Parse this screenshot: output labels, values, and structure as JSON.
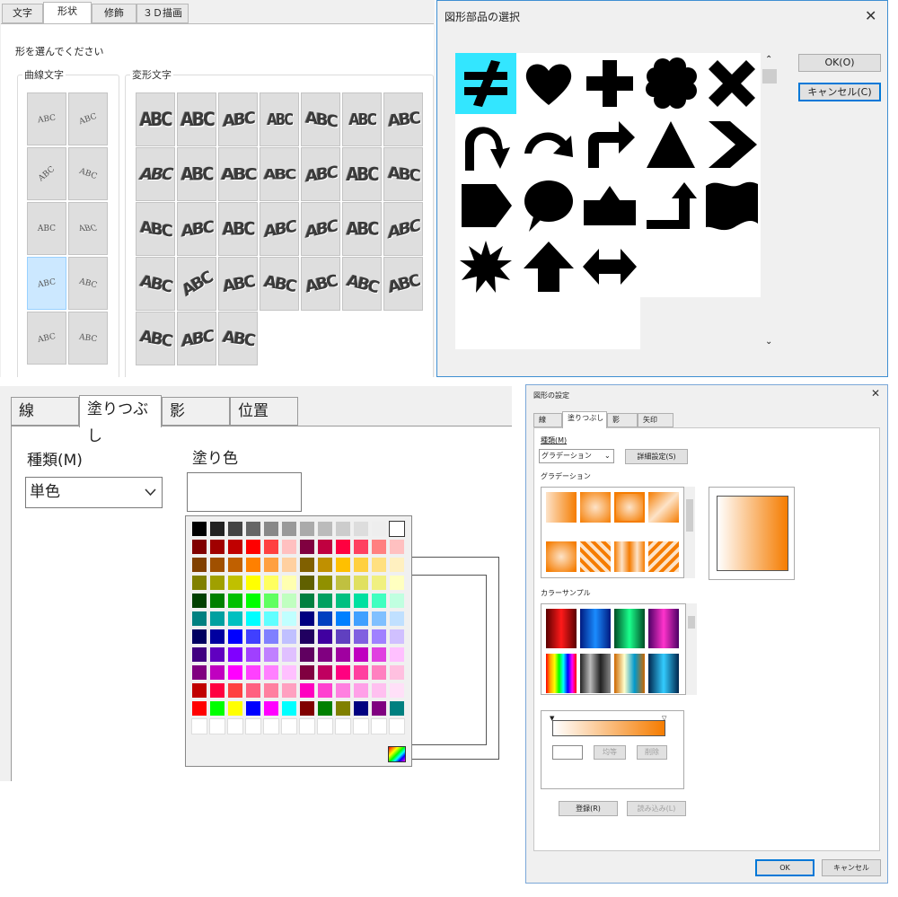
{
  "wordart_panel": {
    "tabs": [
      "文字",
      "形状",
      "修飾",
      "３Ｄ描画"
    ],
    "active_tab": "形状",
    "instruction": "形を選んでください",
    "curve_group_label": "曲線文字",
    "transform_group_label": "変形文字",
    "curve_samples": [
      "ABC",
      "ABC",
      "ABC",
      "ABC",
      "ABC",
      "ABC",
      "ABC",
      "ABC",
      "ABC",
      "ABC"
    ],
    "transform_sample": "ABC"
  },
  "shape_dialog": {
    "title": "図形部品の選択",
    "close": "✕",
    "ok_label": "OK(O)",
    "cancel_label": "キャンセル(C)"
  },
  "fill_panel": {
    "tabs": [
      "線",
      "塗りつぶし",
      "影",
      "位置"
    ],
    "active_tab": "塗りつぶし",
    "type_label": "種類(M)",
    "type_value": "単色",
    "color_label": "塗り色"
  },
  "settings_dialog": {
    "title": "図形の設定",
    "close": "✕",
    "tabs": [
      "線",
      "塗りつぶし",
      "影",
      "矢印"
    ],
    "active_tab": "塗りつぶし",
    "type_label": "種類(M)",
    "type_value": "グラデーション",
    "detail_button": "詳細設定(S)",
    "gradation_label": "グラデーション",
    "color_sample_label": "カラーサンプル",
    "even_button": "均等",
    "delete_button": "削除",
    "register_button": "登録(R)",
    "load_button": "読み込み(L)",
    "ok_label": "OK",
    "cancel_label": "キャンセル",
    "accent_color": "#f57c00"
  }
}
